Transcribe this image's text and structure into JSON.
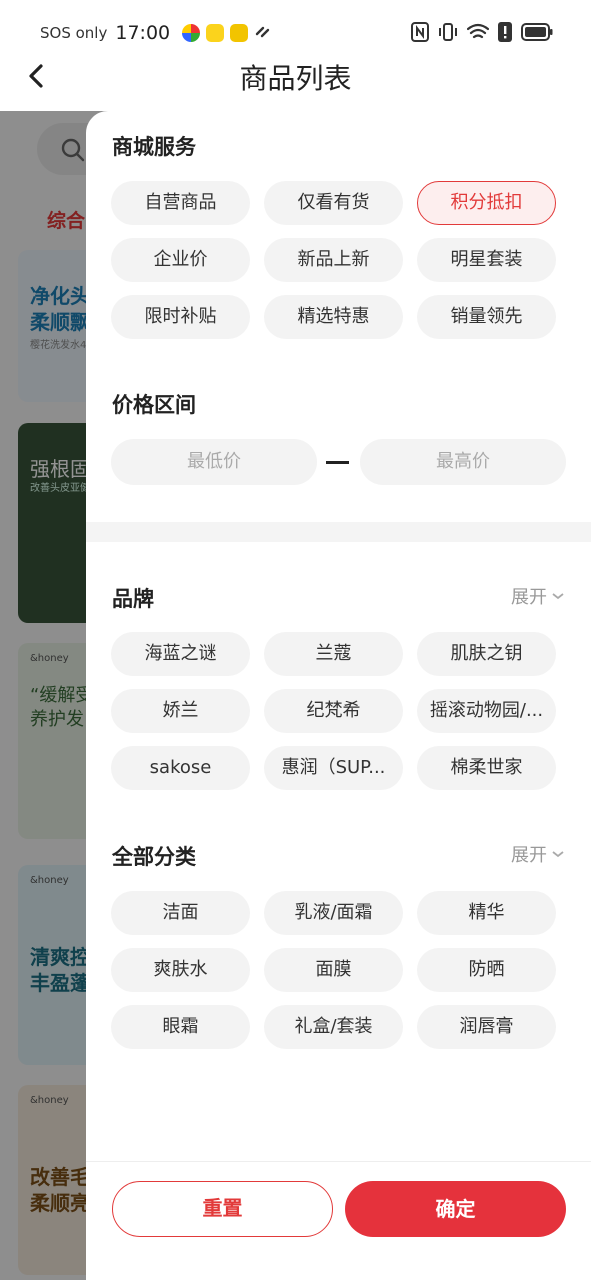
{
  "status_bar": {
    "carrier": "SOS only",
    "time": "17:00"
  },
  "header": {
    "title": "商品列表",
    "back_icon": "chevron-left-icon"
  },
  "background": {
    "active_tab": "综合",
    "cards": [
      {
        "caption": "净化头",
        "caption2": "柔顺飘",
        "sub": "樱花洗发水4"
      },
      {
        "caption": "强根固",
        "caption2": "",
        "sub": "改善头皮亚健"
      },
      {
        "caption": "“缓解受",
        "caption2": "养护发",
        "sub": "&honey"
      },
      {
        "caption": "清爽控",
        "caption2": "丰盈蓬",
        "sub": "&honey"
      },
      {
        "caption": "改善毛",
        "caption2": "柔顺亮",
        "sub": "&honey"
      }
    ]
  },
  "filter": {
    "mall_service": {
      "title": "商城服务",
      "options": [
        "自营商品",
        "仅看有货",
        "积分抵扣",
        "企业价",
        "新品上新",
        "明星套装",
        "限时补贴",
        "精选特惠",
        "销量领先"
      ],
      "selected": "积分抵扣"
    },
    "price": {
      "title": "价格区间",
      "min_placeholder": "最低价",
      "max_placeholder": "最高价"
    },
    "brand": {
      "title": "品牌",
      "expand_label": "展开",
      "options": [
        "海蓝之谜",
        "兰蔻",
        "肌肤之钥",
        "娇兰",
        "纪梵希",
        "摇滚动物园/...",
        "sakose",
        "惠润（SUP...",
        "棉柔世家"
      ]
    },
    "category": {
      "title": "全部分类",
      "expand_label": "展开",
      "options": [
        "洁面",
        "乳液/面霜",
        "精华",
        "爽肤水",
        "面膜",
        "防晒",
        "眼霜",
        "礼盒/套装",
        "润唇膏"
      ]
    },
    "reset_label": "重置",
    "confirm_label": "确定"
  },
  "colors": {
    "accent": "#e5323c",
    "chip_bg": "#f3f3f3",
    "selected_bg": "#fdeeee"
  }
}
